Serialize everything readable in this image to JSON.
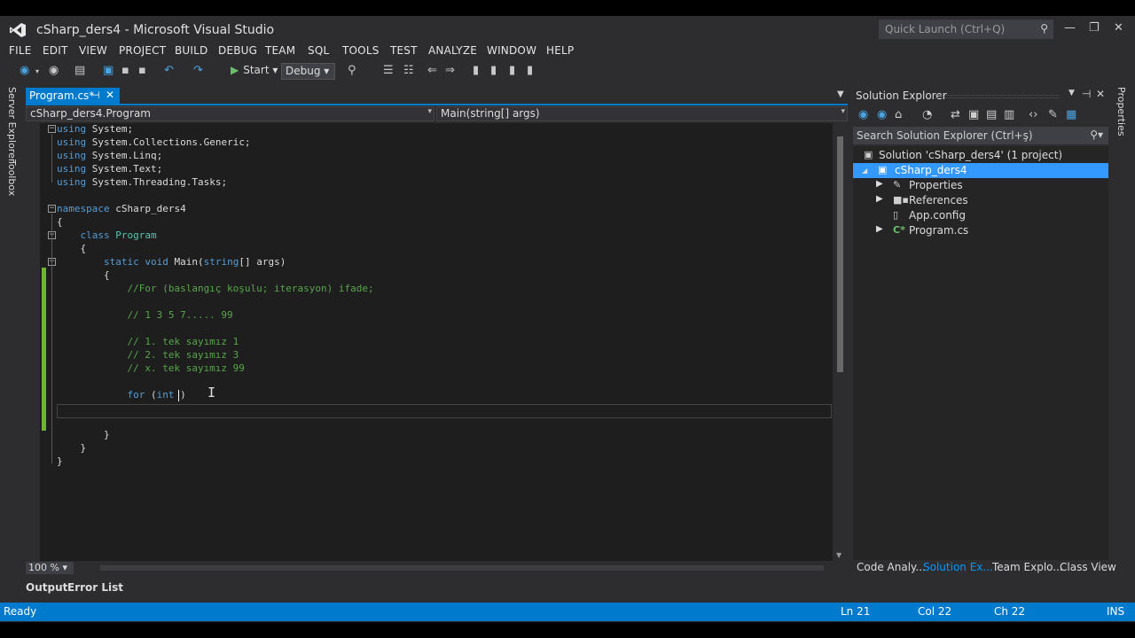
{
  "window": {
    "title": "cSharp_ders4 - Microsoft Visual Studio",
    "quick_launch_placeholder": "Quick Launch (Ctrl+Q)"
  },
  "menu": [
    "FILE",
    "EDIT",
    "VIEW",
    "PROJECT",
    "BUILD",
    "DEBUG",
    "TEAM",
    "SQL",
    "TOOLS",
    "TEST",
    "ANALYZE",
    "WINDOW",
    "HELP"
  ],
  "toolbar": {
    "start_label": "Start",
    "config_value": "Debug"
  },
  "side_tabs": [
    "Server Explorer",
    "Toolbox"
  ],
  "right_side_tab": "Properties",
  "document_tab": {
    "label": "Program.cs*"
  },
  "navbar": {
    "type_scope": "cSharp_ders4.Program",
    "member_scope": "Main(string[] args)"
  },
  "code": {
    "lines": [
      {
        "t": "using System;"
      },
      {
        "t": "using System.Collections.Generic;"
      },
      {
        "t": "using System.Linq;"
      },
      {
        "t": "using System.Text;"
      },
      {
        "t": "using System.Threading.Tasks;"
      },
      {
        "t": ""
      },
      {
        "t": "namespace cSharp_ders4"
      },
      {
        "t": "{"
      },
      {
        "t": "    class Program"
      },
      {
        "t": "    {"
      },
      {
        "t": "        static void Main(string[] args)"
      },
      {
        "t": "        {"
      },
      {
        "t": "            //For (baslangıç koşulu; iterasyon) ifade;"
      },
      {
        "t": ""
      },
      {
        "t": "            // 1 3 5 7..... 99"
      },
      {
        "t": ""
      },
      {
        "t": "            // 1. tek sayımız 1"
      },
      {
        "t": "            // 2. tek sayımız 3"
      },
      {
        "t": "            // x. tek sayımız 99"
      },
      {
        "t": ""
      },
      {
        "t": "            for (int )"
      },
      {
        "t": ""
      },
      {
        "t": ""
      },
      {
        "t": "        }"
      },
      {
        "t": "    }"
      },
      {
        "t": "}"
      }
    ]
  },
  "editor": {
    "zoom": "100 %"
  },
  "output_tabs": [
    "Output",
    "Error List"
  ],
  "solution_explorer": {
    "title": "Solution Explorer",
    "search_placeholder": "Search Solution Explorer (Ctrl+ş)",
    "tree": [
      {
        "label": "Solution 'cSharp_ders4' (1 project)",
        "icon": "solution-icon",
        "expander": ""
      },
      {
        "label": "cSharp_ders4",
        "icon": "csharp-project-icon",
        "expander": "◢",
        "selected": true
      },
      {
        "label": "Properties",
        "icon": "wrench-icon",
        "expander": "▶"
      },
      {
        "label": "References",
        "icon": "references-icon",
        "expander": "▶"
      },
      {
        "label": "App.config",
        "icon": "config-file-icon",
        "expander": ""
      },
      {
        "label": "Program.cs",
        "icon": "csharp-file-icon",
        "expander": "▶"
      }
    ],
    "bottom_tabs": [
      "Code Analy...",
      "Solution Ex...",
      "Team Explo...",
      "Class View"
    ],
    "active_tab": "Solution Ex..."
  },
  "status": {
    "message": "Ready",
    "line": "Ln 21",
    "col": "Col 22",
    "ch": "Ch 22",
    "mode": "INS"
  },
  "colors": {
    "accent": "#007acc",
    "editor_bg": "#1e1e1e",
    "keyword": "#569cd6",
    "type": "#4ec9b0",
    "comment": "#57a64a"
  }
}
